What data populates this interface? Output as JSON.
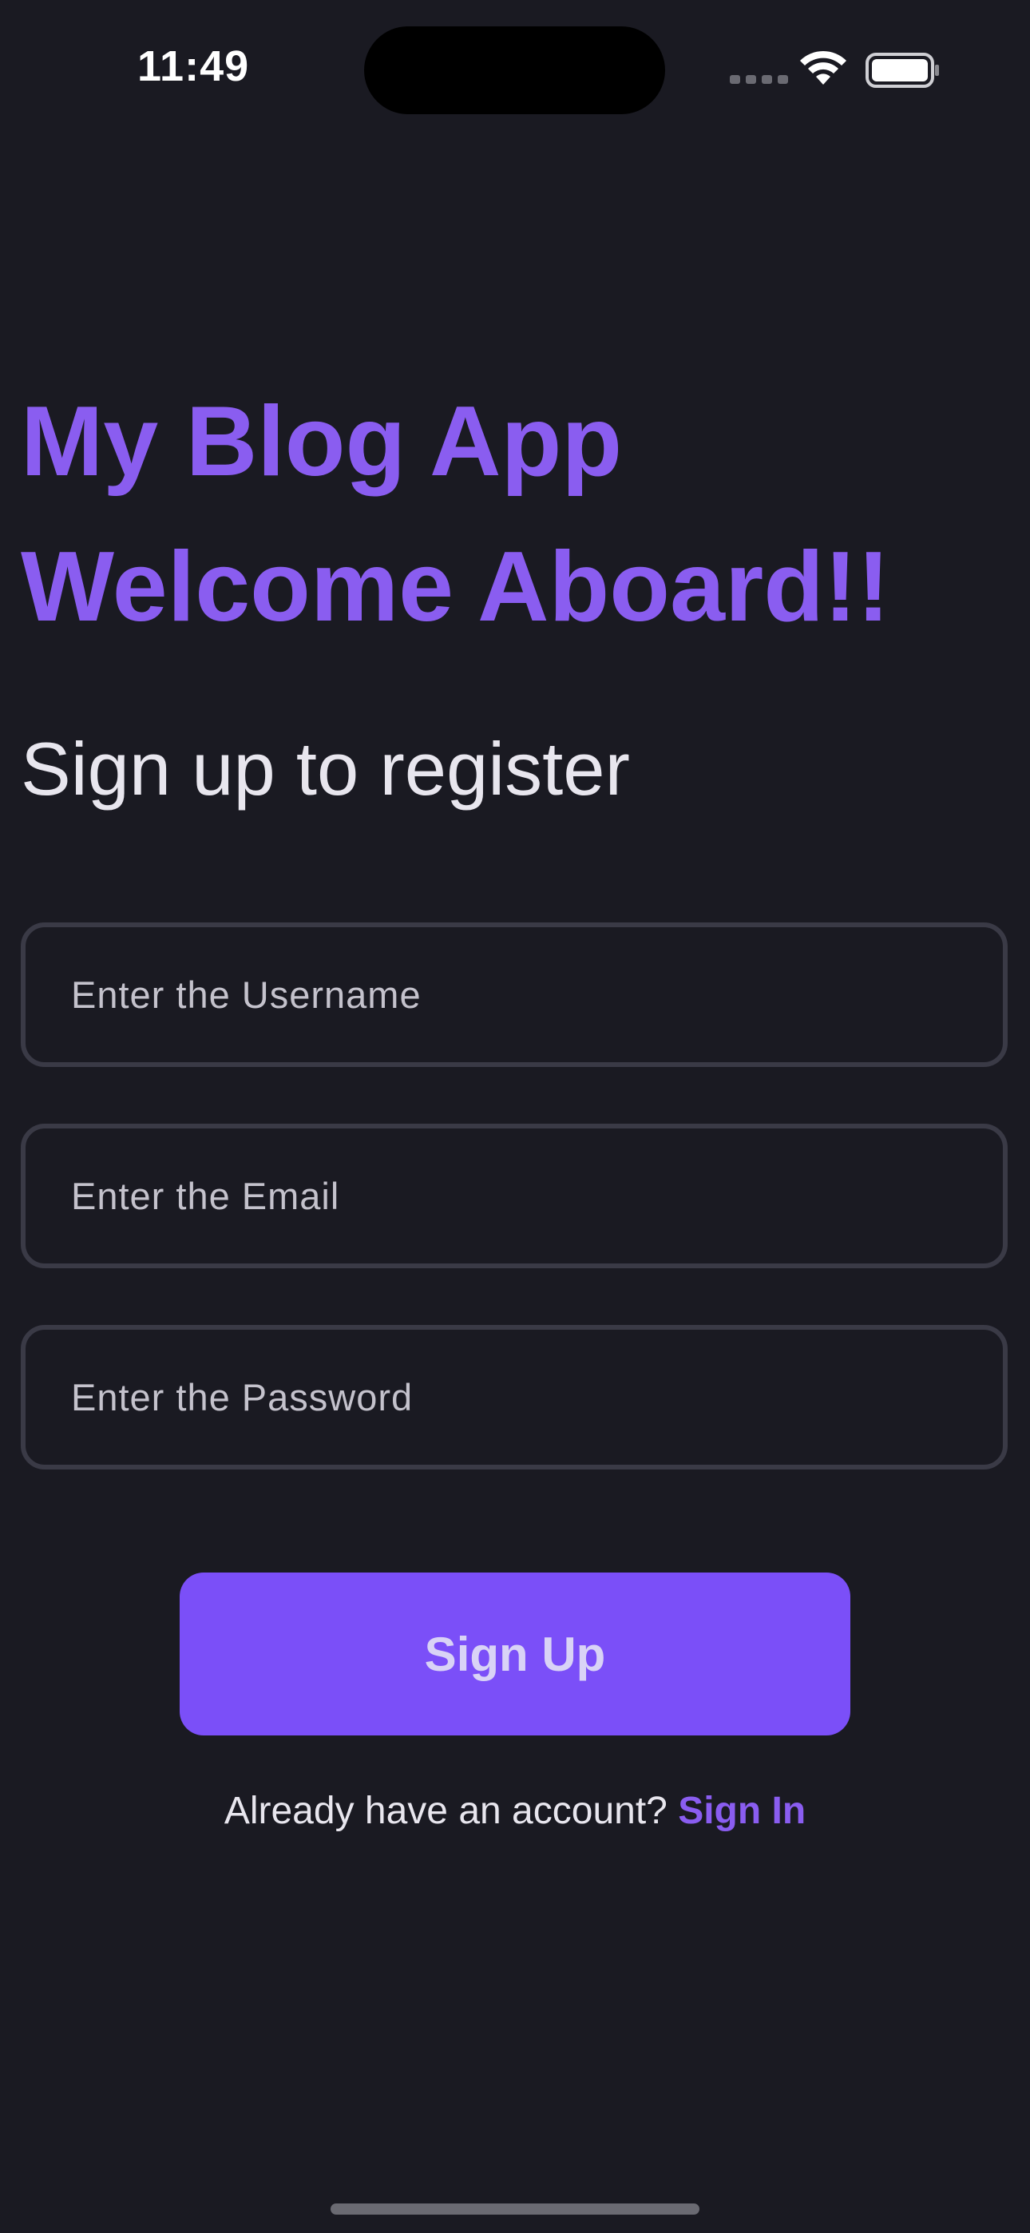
{
  "status_bar": {
    "time": "11:49",
    "signal_icon": "cellular-signal-icon",
    "wifi_icon": "wifi-icon",
    "battery_icon": "battery-icon"
  },
  "header": {
    "title_line1": "My Blog App",
    "title_line2": "Welcome Aboard!!",
    "subtitle": "Sign up to register"
  },
  "form": {
    "username": {
      "value": "",
      "placeholder": "Enter the Username"
    },
    "email": {
      "value": "",
      "placeholder": "Enter the Email"
    },
    "password": {
      "value": "",
      "placeholder": "Enter the Password"
    },
    "submit_label": "Sign Up"
  },
  "footer": {
    "prompt": "Already have an account?",
    "link_label": "Sign In"
  },
  "colors": {
    "background": "#1a1a22",
    "accent": "#8a5df0",
    "button": "#7b4ff8",
    "field_border": "#3a3a46"
  }
}
